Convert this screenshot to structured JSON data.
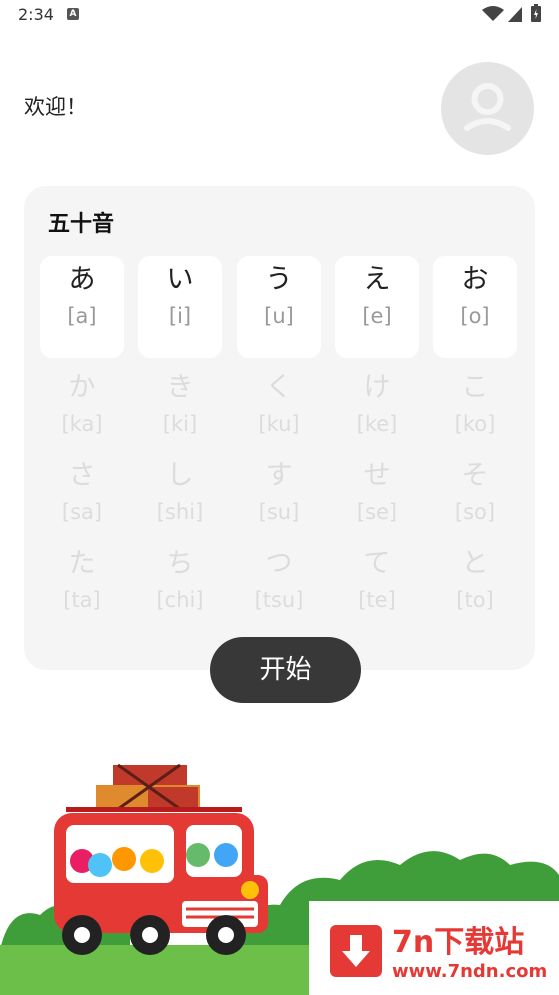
{
  "status_bar": {
    "time": "2:34",
    "icons": [
      "a-notification-icon",
      "wifi-icon",
      "signal-icon",
      "battery-icon"
    ]
  },
  "header": {
    "greeting": "欢迎！",
    "avatar_icon": "user-icon"
  },
  "card": {
    "title": "五十音",
    "rows": [
      [
        {
          "kana": "あ",
          "romaji": "[a]"
        },
        {
          "kana": "い",
          "romaji": "[i]"
        },
        {
          "kana": "う",
          "romaji": "[u]"
        },
        {
          "kana": "え",
          "romaji": "[e]"
        },
        {
          "kana": "お",
          "romaji": "[o]"
        }
      ],
      [
        {
          "kana": "か",
          "romaji": "[ka]"
        },
        {
          "kana": "き",
          "romaji": "[ki]"
        },
        {
          "kana": "く",
          "romaji": "[ku]"
        },
        {
          "kana": "け",
          "romaji": "[ke]"
        },
        {
          "kana": "こ",
          "romaji": "[ko]"
        }
      ],
      [
        {
          "kana": "さ",
          "romaji": "[sa]"
        },
        {
          "kana": "し",
          "romaji": "[shi]"
        },
        {
          "kana": "す",
          "romaji": "[su]"
        },
        {
          "kana": "せ",
          "romaji": "[se]"
        },
        {
          "kana": "そ",
          "romaji": "[so]"
        }
      ],
      [
        {
          "kana": "た",
          "romaji": "[ta]"
        },
        {
          "kana": "ち",
          "romaji": "[chi]"
        },
        {
          "kana": "つ",
          "romaji": "[tsu]"
        },
        {
          "kana": "て",
          "romaji": "[te]"
        },
        {
          "kana": "と",
          "romaji": "[to]"
        }
      ]
    ]
  },
  "start_button": {
    "label": "开始"
  },
  "watermark": {
    "title": "7n下载站",
    "url": "www.7ndn.com"
  },
  "colors": {
    "button": "#383838",
    "card": "#f5f5f5",
    "bus": "#e53935",
    "grass": "#6cc04a",
    "bush": "#3f9e3a"
  }
}
